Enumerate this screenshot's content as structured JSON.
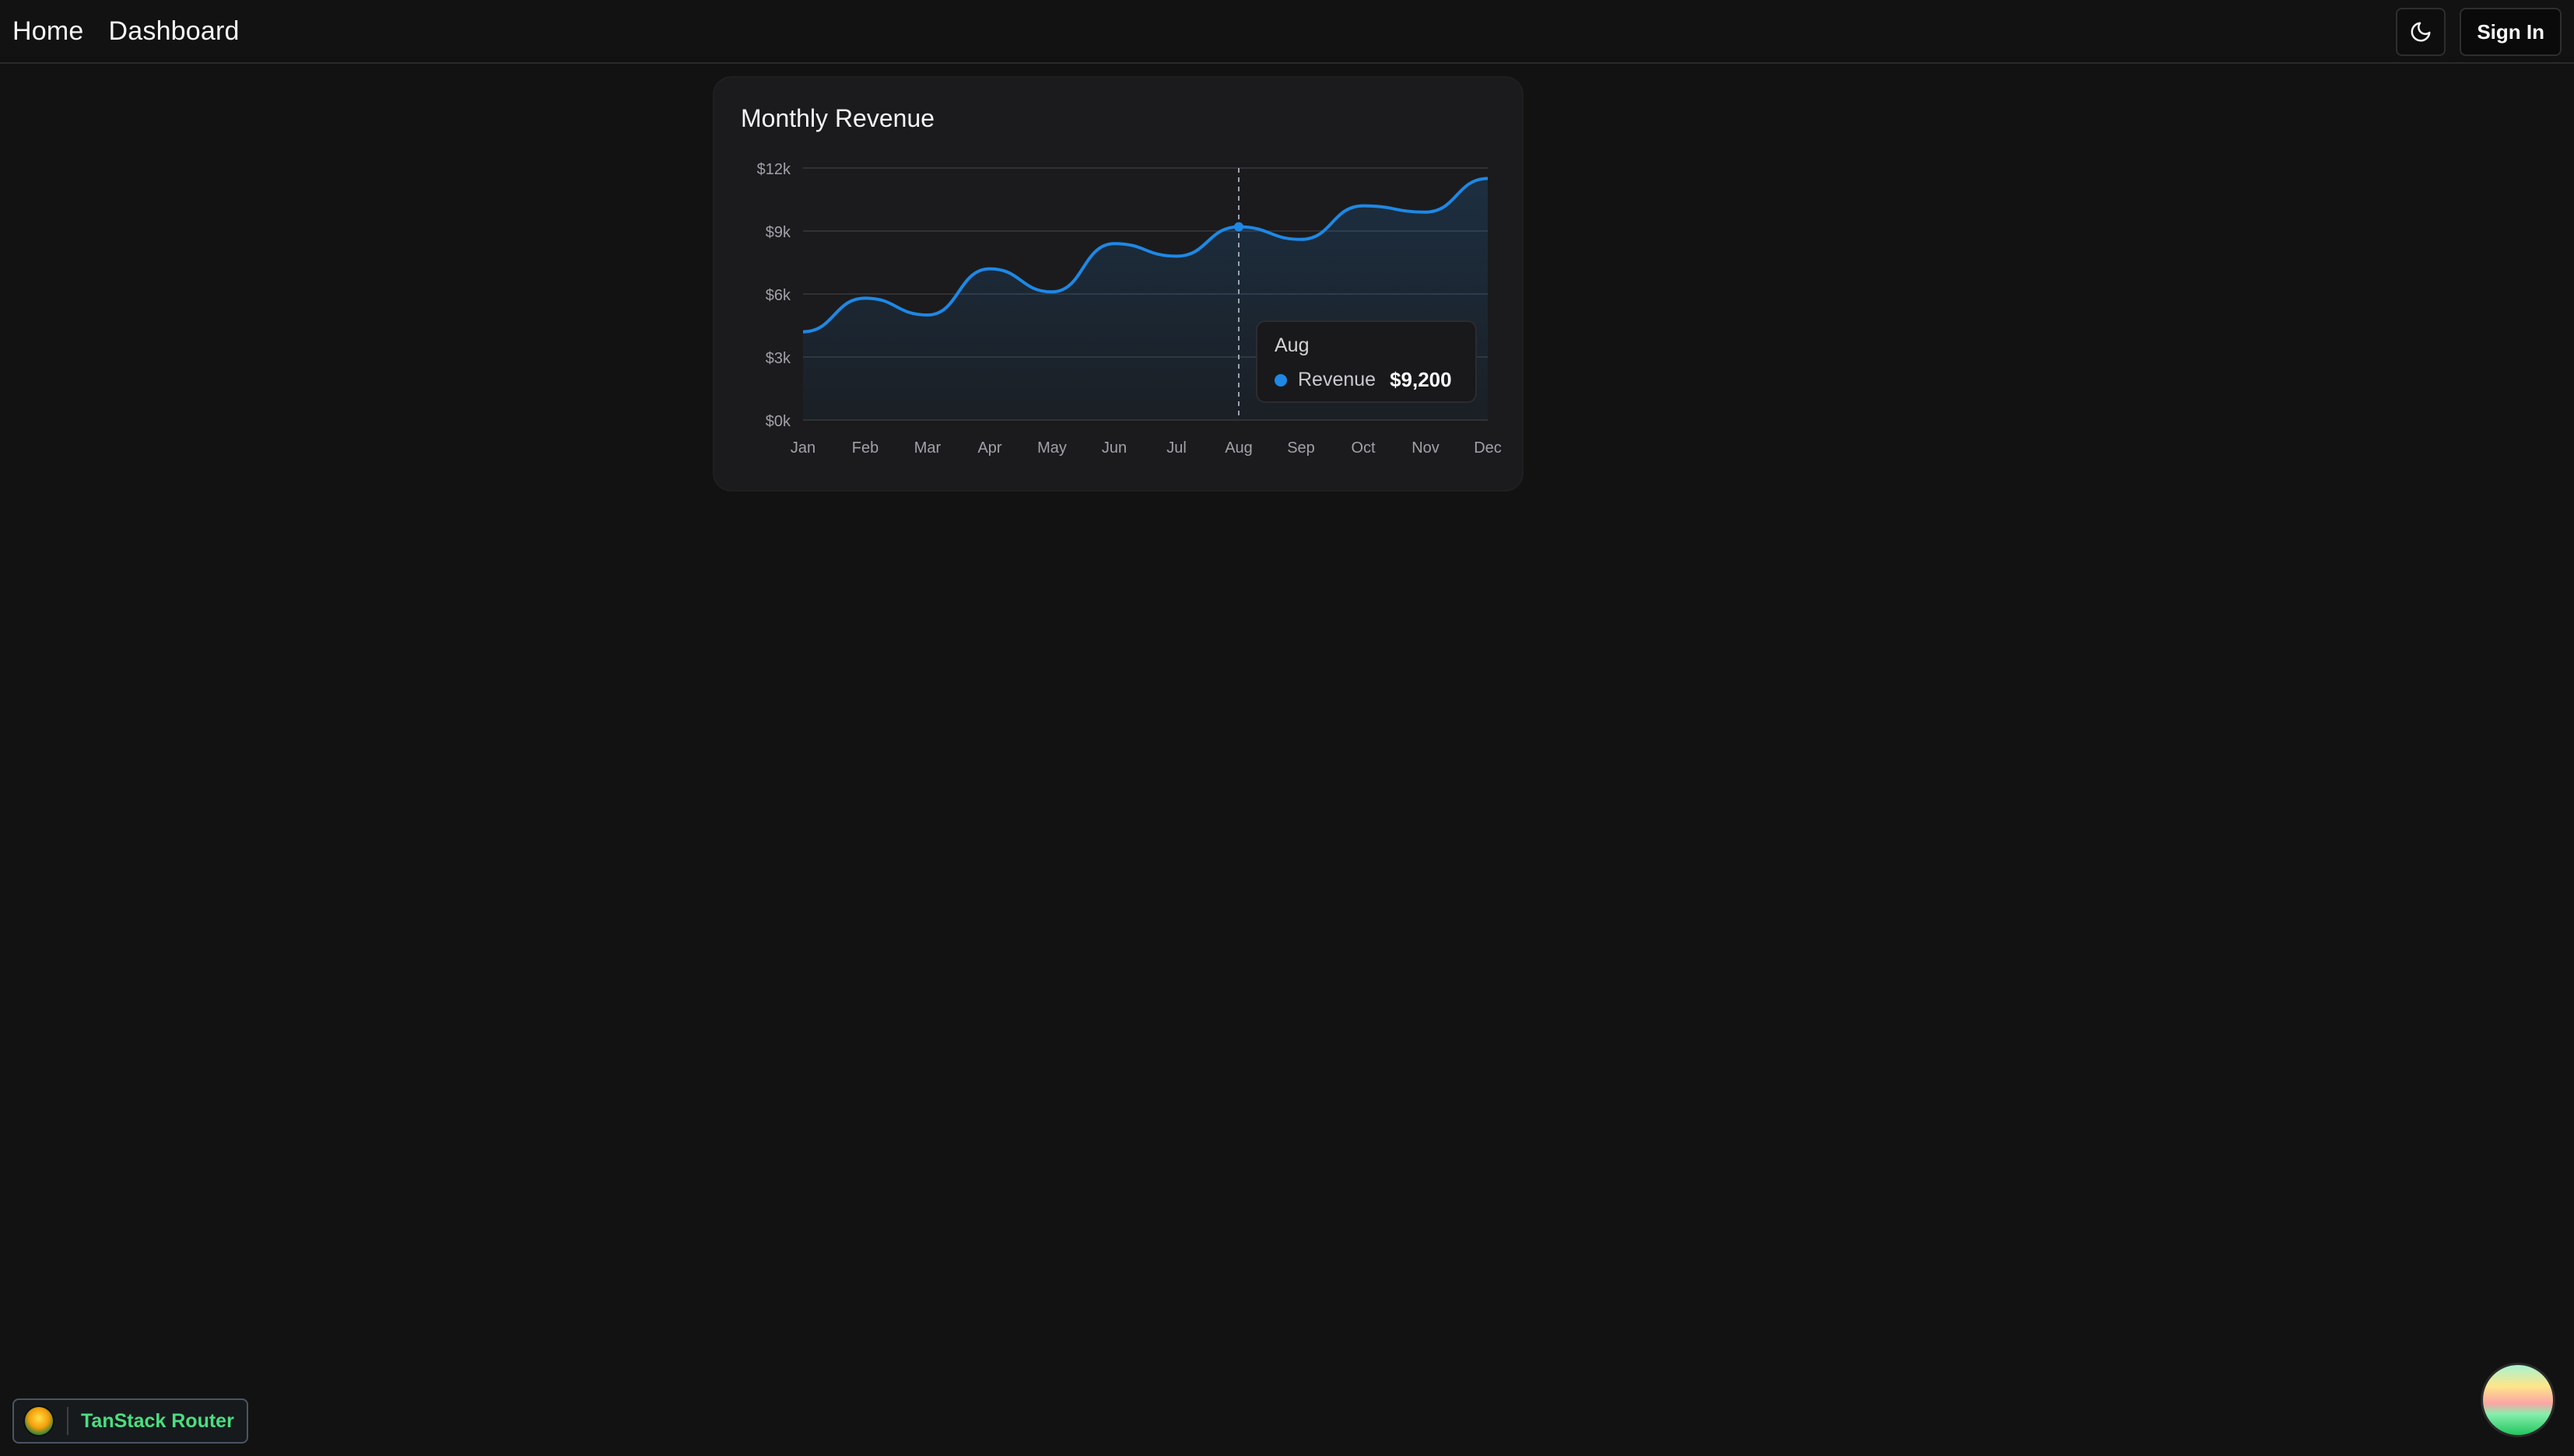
{
  "nav": {
    "home_label": "Home",
    "dashboard_label": "Dashboard",
    "signin_label": "Sign In",
    "theme_icon": "moon-icon"
  },
  "card": {
    "title": "Monthly Revenue"
  },
  "tooltip": {
    "month": "Aug",
    "series_label": "Revenue",
    "value": "$9,200"
  },
  "footer": {
    "router_label": "TanStack Router"
  },
  "colors": {
    "accent": "#1e88e5",
    "background": "#121212",
    "card": "#1b1b1d",
    "router_green": "#4ade80"
  },
  "chart_data": {
    "type": "area",
    "categories": [
      "Jan",
      "Feb",
      "Mar",
      "Apr",
      "May",
      "Jun",
      "Jul",
      "Aug",
      "Sep",
      "Oct",
      "Nov",
      "Dec"
    ],
    "series": [
      {
        "name": "Revenue",
        "values": [
          4200,
          5800,
          5000,
          7200,
          6100,
          8400,
          7800,
          9200,
          8600,
          10200,
          9900,
          11500
        ]
      }
    ],
    "y_ticks": [
      "$0k",
      "$3k",
      "$6k",
      "$9k",
      "$12k"
    ],
    "ylim": [
      0,
      12000
    ],
    "grid": true,
    "highlighted_category": "Aug"
  }
}
